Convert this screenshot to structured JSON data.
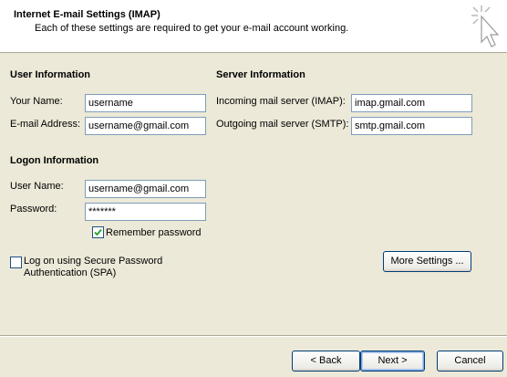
{
  "header": {
    "title": "Internet E-mail Settings (IMAP)",
    "subtitle": "Each of these settings are required to get your e-mail account working."
  },
  "user_info": {
    "heading": "User Information",
    "your_name_label": "Your Name:",
    "your_name_value": "username",
    "email_label": "E-mail Address:",
    "email_value": "username@gmail.com"
  },
  "server_info": {
    "heading": "Server Information",
    "incoming_label": "Incoming mail server (IMAP):",
    "incoming_value": "imap.gmail.com",
    "outgoing_label": "Outgoing mail server (SMTP):",
    "outgoing_value": "smtp.gmail.com"
  },
  "logon_info": {
    "heading": "Logon Information",
    "username_label": "User Name:",
    "username_value": "username@gmail.com",
    "password_label": "Password:",
    "password_value": "*******",
    "remember_label": "Remember password",
    "remember_checked": true
  },
  "spa": {
    "label_line1": "Log on using Secure Password",
    "label_line2": "Authentication (SPA)",
    "checked": false
  },
  "buttons": {
    "more_settings": "More Settings ...",
    "back": "< Back",
    "next": "Next >",
    "cancel": "Cancel"
  },
  "icons": {
    "header_icon": "cursor-click-icon",
    "check_icon": "checkmark-icon"
  },
  "colors": {
    "dialog_bg": "#ece9d8",
    "header_bg": "#ffffff",
    "field_border": "#7f9db9",
    "check_color": "#21a121"
  }
}
